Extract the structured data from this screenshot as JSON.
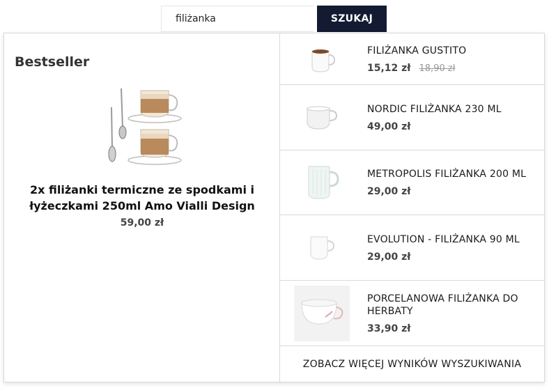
{
  "search": {
    "value": "filiżanka",
    "button_label": "SZUKAJ"
  },
  "bestseller": {
    "title": "Bestseller",
    "product_name": "2x filiżanki termiczne ze spodkami i łyżeczkami 250ml Amo Vialli Design",
    "price": "59,00 zł"
  },
  "results": [
    {
      "name": "FILIŻANKA GUSTITO",
      "price": "15,12 zł",
      "old_price": "18,90 zł"
    },
    {
      "name": "NORDIC FILIŻANKA 230 ML",
      "price": "49,00 zł",
      "old_price": ""
    },
    {
      "name": "METROPOLIS FILIŻANKA 200 ML",
      "price": "29,00 zł",
      "old_price": ""
    },
    {
      "name": "EVOLUTION - FILIŻANKA 90 ML",
      "price": "29,00 zł",
      "old_price": ""
    },
    {
      "name": "PORCELANOWA FILIŻANKA DO HERBATY",
      "price": "33,90 zł",
      "old_price": ""
    }
  ],
  "more_results_label": "ZOBACZ WIĘCEJ WYNIKÓW WYSZUKIWANIA",
  "colors": {
    "button_bg": "#121b32",
    "border": "#d9d9d9",
    "price": "#444444",
    "old_price": "#999999"
  }
}
